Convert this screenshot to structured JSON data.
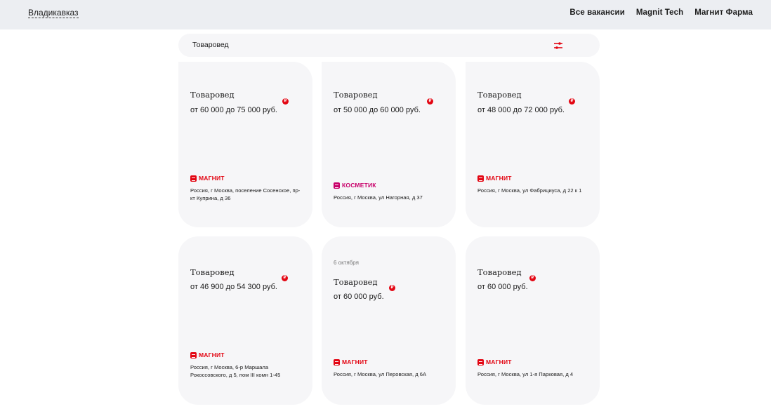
{
  "header": {
    "city": "Владикавказ",
    "nav": [
      "Все вакансии",
      "Magnit Tech",
      "Магнит Фарма"
    ]
  },
  "search": {
    "query": "Товаровед",
    "filter_icon": "filter-icon"
  },
  "colors": {
    "accent": "#e30613",
    "cosmetic": "#c8006a",
    "card_bg": "#f6f6f8",
    "header_bg": "#eceef2"
  },
  "cards": [
    {
      "date": "",
      "title": "Товаровед",
      "salary": "от 60 000 до 75 000 руб.",
      "brand": "МАГНИТ",
      "address": "Россия, г Москва, поселение Сосенское, пр-кт Куприна, д 36"
    },
    {
      "date": "",
      "title": "Товаровед",
      "salary": "от 50 000 до 60 000 руб.",
      "brand": "КОСМЕТИК",
      "address": "Россия, г Москва, ул Нагорная, д 37"
    },
    {
      "date": "",
      "title": "Товаровед",
      "salary": "от 48 000 до 72 000 руб.",
      "brand": "МАГНИТ",
      "address": "Россия, г Москва, ул Фабрициуса, д 22 к 1"
    },
    {
      "date": "",
      "title": "Товаровед",
      "salary": "от 46 900 до 54 300 руб.",
      "brand": "МАГНИТ",
      "address": "Россия, г Москва, 6-р Маршала Рокоссовского, д 5, пом III комн 1-45"
    },
    {
      "date": "6 октября",
      "title": "Товаровед",
      "salary": "от 60 000 руб.",
      "brand": "МАГНИТ",
      "address": "Россия, г Москва, ул Перовская, д 6А"
    },
    {
      "date": "",
      "title": "Товаровед",
      "salary": "от 60 000 руб.",
      "brand": "МАГНИТ",
      "address": "Россия, г Москва, ул 1-я Парковая, д 4"
    }
  ],
  "currency_badge": "₽"
}
